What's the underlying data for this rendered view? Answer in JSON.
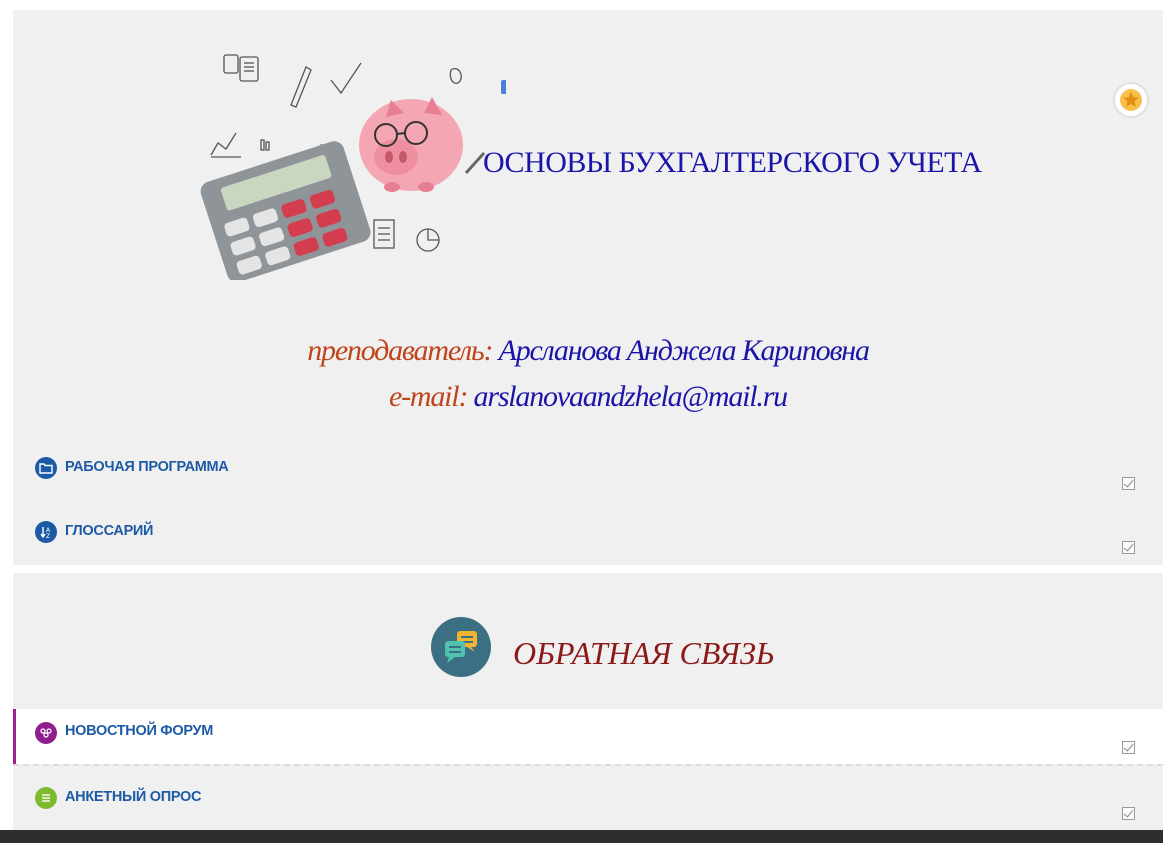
{
  "course": {
    "title": "ОСНОВЫ БУХГАЛТЕРСКОГО УЧЕТА",
    "teacher_label": "преподаватель:",
    "teacher_name": "Арсланова Анджела Кариповна",
    "email_label": "e-mail:",
    "email_value": "arslanovaandzhela@mail.ru"
  },
  "section1": {
    "activities": [
      {
        "label": "РАБОЧАЯ ПРОГРАММА",
        "icon": "folder-icon",
        "color": "#1d5aa6"
      },
      {
        "label": "ГЛОССАРИЙ",
        "icon": "glossary-icon",
        "color": "#1d5aa6"
      }
    ]
  },
  "section2": {
    "title": "ОБРАТНАЯ СВЯЗЬ",
    "activities": [
      {
        "label": "НОВОСТНОЙ ФОРУМ",
        "icon": "forum-icon",
        "color": "#8e1f8c"
      },
      {
        "label": "АНКЕТНЫЙ ОПРОС",
        "icon": "survey-icon",
        "color": "#7dbb2e"
      }
    ]
  },
  "colors": {
    "title_blue": "#1a15a8",
    "label_red": "#c0441a",
    "feedback_red": "#8b1a1a",
    "link_blue": "#1d5aa6",
    "star_orange": "#f0a523"
  }
}
